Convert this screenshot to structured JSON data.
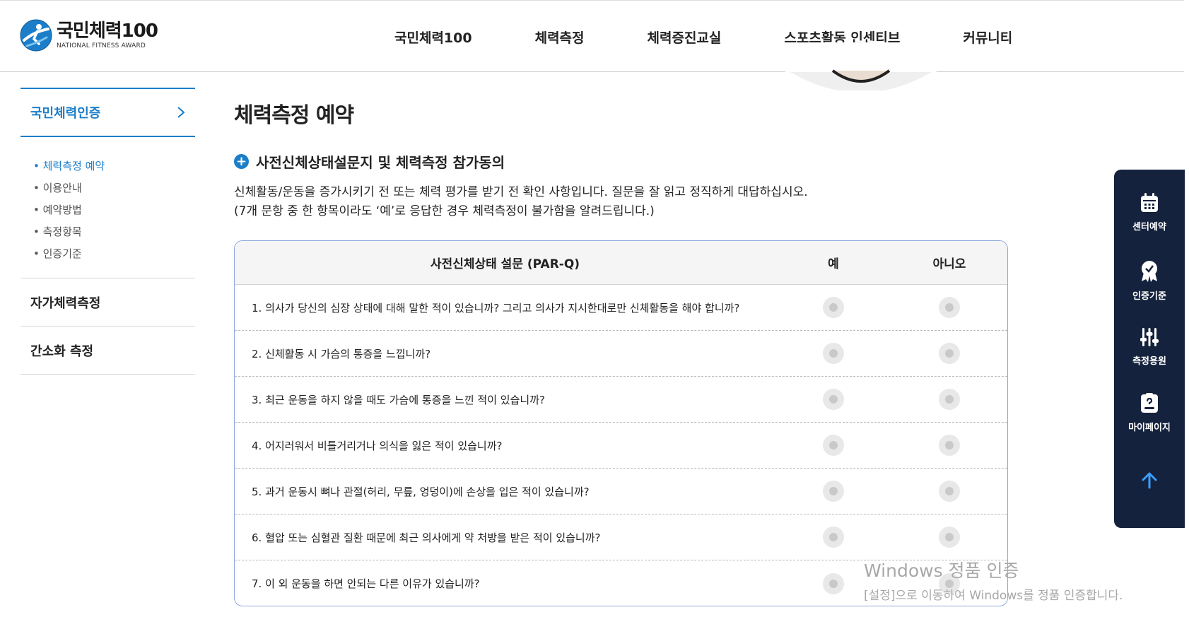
{
  "header": {
    "logo_title": "국민체력100",
    "logo_sub": "NATIONAL FITNESS AWARD",
    "nav": [
      "국민체력100",
      "체력측정",
      "체력증진교실",
      "스포츠활동 인센티브",
      "커뮤니티"
    ]
  },
  "sidebar": {
    "main": "국민체력인증",
    "sub_items": [
      "체력측정 예약",
      "이용안내",
      "예약방법",
      "측정항목",
      "인증기준"
    ],
    "active_sub": "체력측정 예약",
    "items": [
      "자가체력측정",
      "간소화 측정"
    ]
  },
  "content": {
    "page_title": "체력측정 예약",
    "section_title": "사전신체상태설문지 및 체력측정 참가동의",
    "desc_line1": "신체활동/운동을 증가시키기 전 또는 체력 평가를 받기 전 확인 사항입니다. 질문을 잘 읽고 정직하게 대답하십시오.",
    "desc_line2": "(7개 문항 중 한 항목이라도 ‘예’로 응답한 경우 체력측정이 불가함을 알려드립니다.)"
  },
  "table": {
    "header_question": "사전신체상태 설문 (PAR-Q)",
    "header_yes": "예",
    "header_no": "아니오",
    "questions": [
      "1. 의사가 당신의 심장 상태에 대해 말한 적이 있습니까? 그리고 의사가 지시한대로만 신체활동을 해야 합니까?",
      "2. 신체활동 시 가슴의 통증을 느낍니까?",
      "3. 최근 운동을 하지 않을 때도 가슴에 통증을 느낀 적이 있습니까?",
      "4. 어지러워서 비틀거리거나 의식을 잃은 적이 있습니까?",
      "5. 과거 운동시 뼈나 관절(허리, 무릎, 엉덩이)에 손상을 입은 적이 있습니까?",
      "6. 혈압 또는 심혈관 질환 때문에 최근 의사에게 약 처방을 받은 적이 있습니까?",
      "7. 이 외 운동을 하면 안되는 다른 이유가 있습니까?"
    ]
  },
  "quick_menu": [
    "센터예약",
    "인증기준",
    "측정용원",
    "마이페이지"
  ],
  "watermark": {
    "line1": "Windows 정품 인증",
    "line2": "[설정]으로 이동하여 Windows를 정품 인증합니다."
  },
  "colors": {
    "accent": "#1c7ec9",
    "quick_bg": "#15223d",
    "table_border": "#8fa9dc"
  }
}
